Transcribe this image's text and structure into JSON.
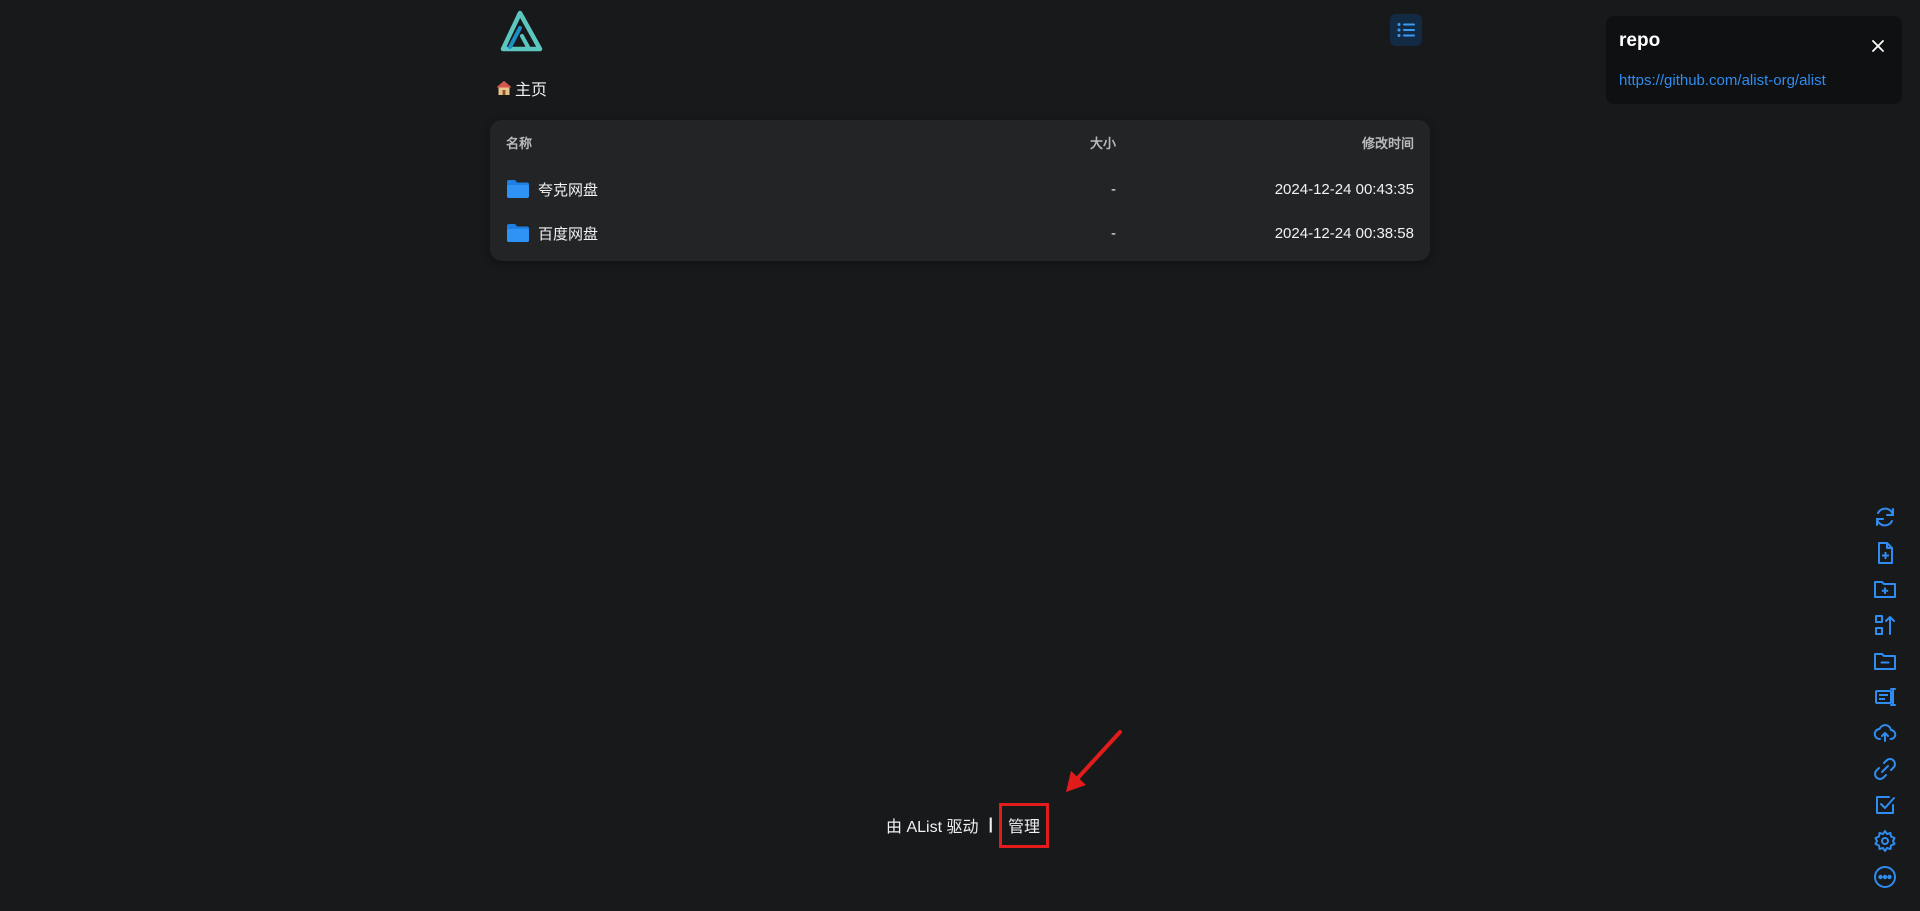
{
  "breadcrumb": {
    "home_label": "主页"
  },
  "file_list": {
    "columns": {
      "name": "名称",
      "size": "大小",
      "modified": "修改时间"
    },
    "rows": [
      {
        "name": "夸克网盘",
        "size": "-",
        "modified": "2024-12-24 00:43:35"
      },
      {
        "name": "百度网盘",
        "size": "-",
        "modified": "2024-12-24 00:38:58"
      }
    ]
  },
  "notification": {
    "title": "repo",
    "link": "https://github.com/alist-org/alist"
  },
  "toolbar": {
    "icons": [
      "refresh-icon",
      "new-file-icon",
      "new-folder-icon",
      "rename-move-icon",
      "folder-minus-icon",
      "screen-icon",
      "cloud-upload-icon",
      "link-icon",
      "check-square-icon",
      "gear-icon",
      "more-icon"
    ]
  },
  "footer": {
    "powered_by": "由 AList 驱动",
    "separator": "|",
    "manage_label": "管理"
  },
  "colors": {
    "background": "#18191b",
    "card": "#222426",
    "accent": "#2f8cf0",
    "logo": "#5cc6c0",
    "highlight": "#e21b1b"
  }
}
